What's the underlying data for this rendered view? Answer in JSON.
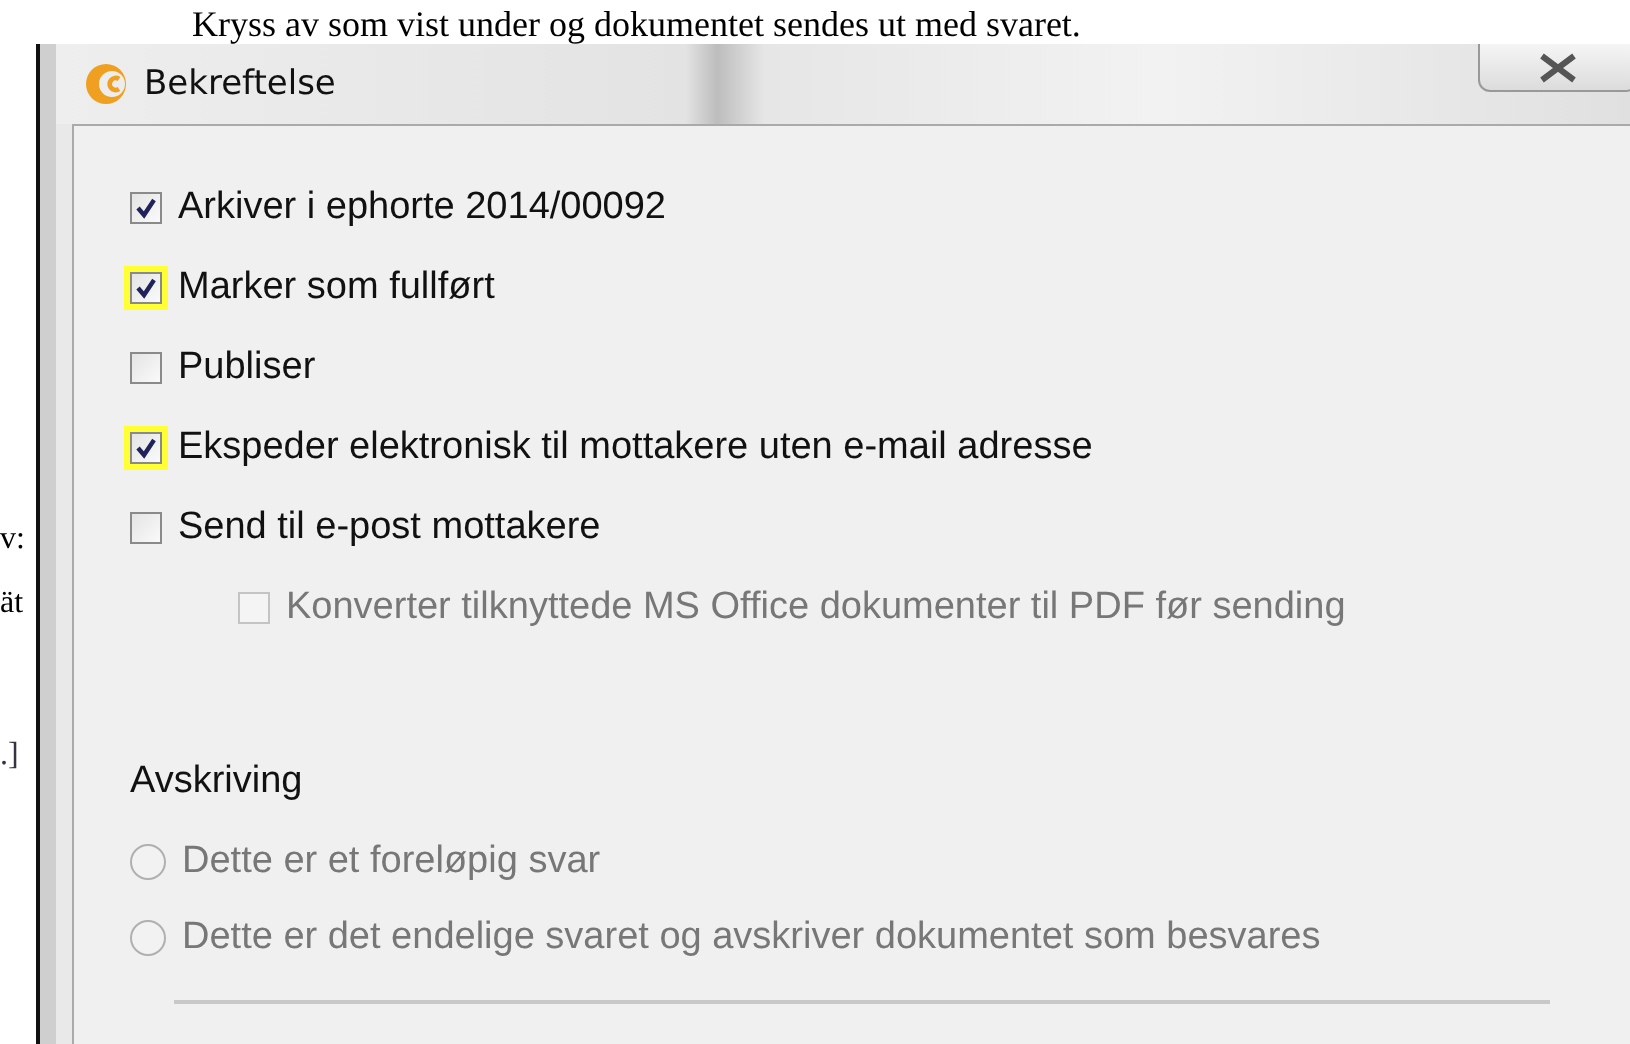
{
  "document": {
    "caption": "Kryss av som vist under og dokumentet sendes ut med svaret.",
    "margin_fragments": [
      "v:",
      "ät",
      ".]"
    ]
  },
  "dialog": {
    "title": "Bekreftelse",
    "options": [
      {
        "label": "Arkiver i ephorte 2014/00092",
        "checked": true,
        "highlighted": false,
        "disabled": false
      },
      {
        "label": "Marker som fullført",
        "checked": true,
        "highlighted": true,
        "disabled": false
      },
      {
        "label": "Publiser",
        "checked": false,
        "highlighted": false,
        "disabled": false
      },
      {
        "label": "Ekspeder elektronisk til mottakere uten e-mail adresse",
        "checked": true,
        "highlighted": true,
        "disabled": false
      },
      {
        "label": "Send til e-post mottakere",
        "checked": false,
        "highlighted": false,
        "disabled": false,
        "children": [
          {
            "label": "Konverter tilknyttede MS Office dokumenter til PDF før sending",
            "checked": false,
            "highlighted": false,
            "disabled": true
          }
        ]
      }
    ],
    "section": {
      "title": "Avskriving",
      "choices": [
        {
          "label": "Dette er et foreløpig svar",
          "selected": false,
          "disabled": true
        },
        {
          "label": "Dette er det endelige svaret og avskriver dokumentet som besvares",
          "selected": false,
          "disabled": true
        }
      ]
    }
  }
}
